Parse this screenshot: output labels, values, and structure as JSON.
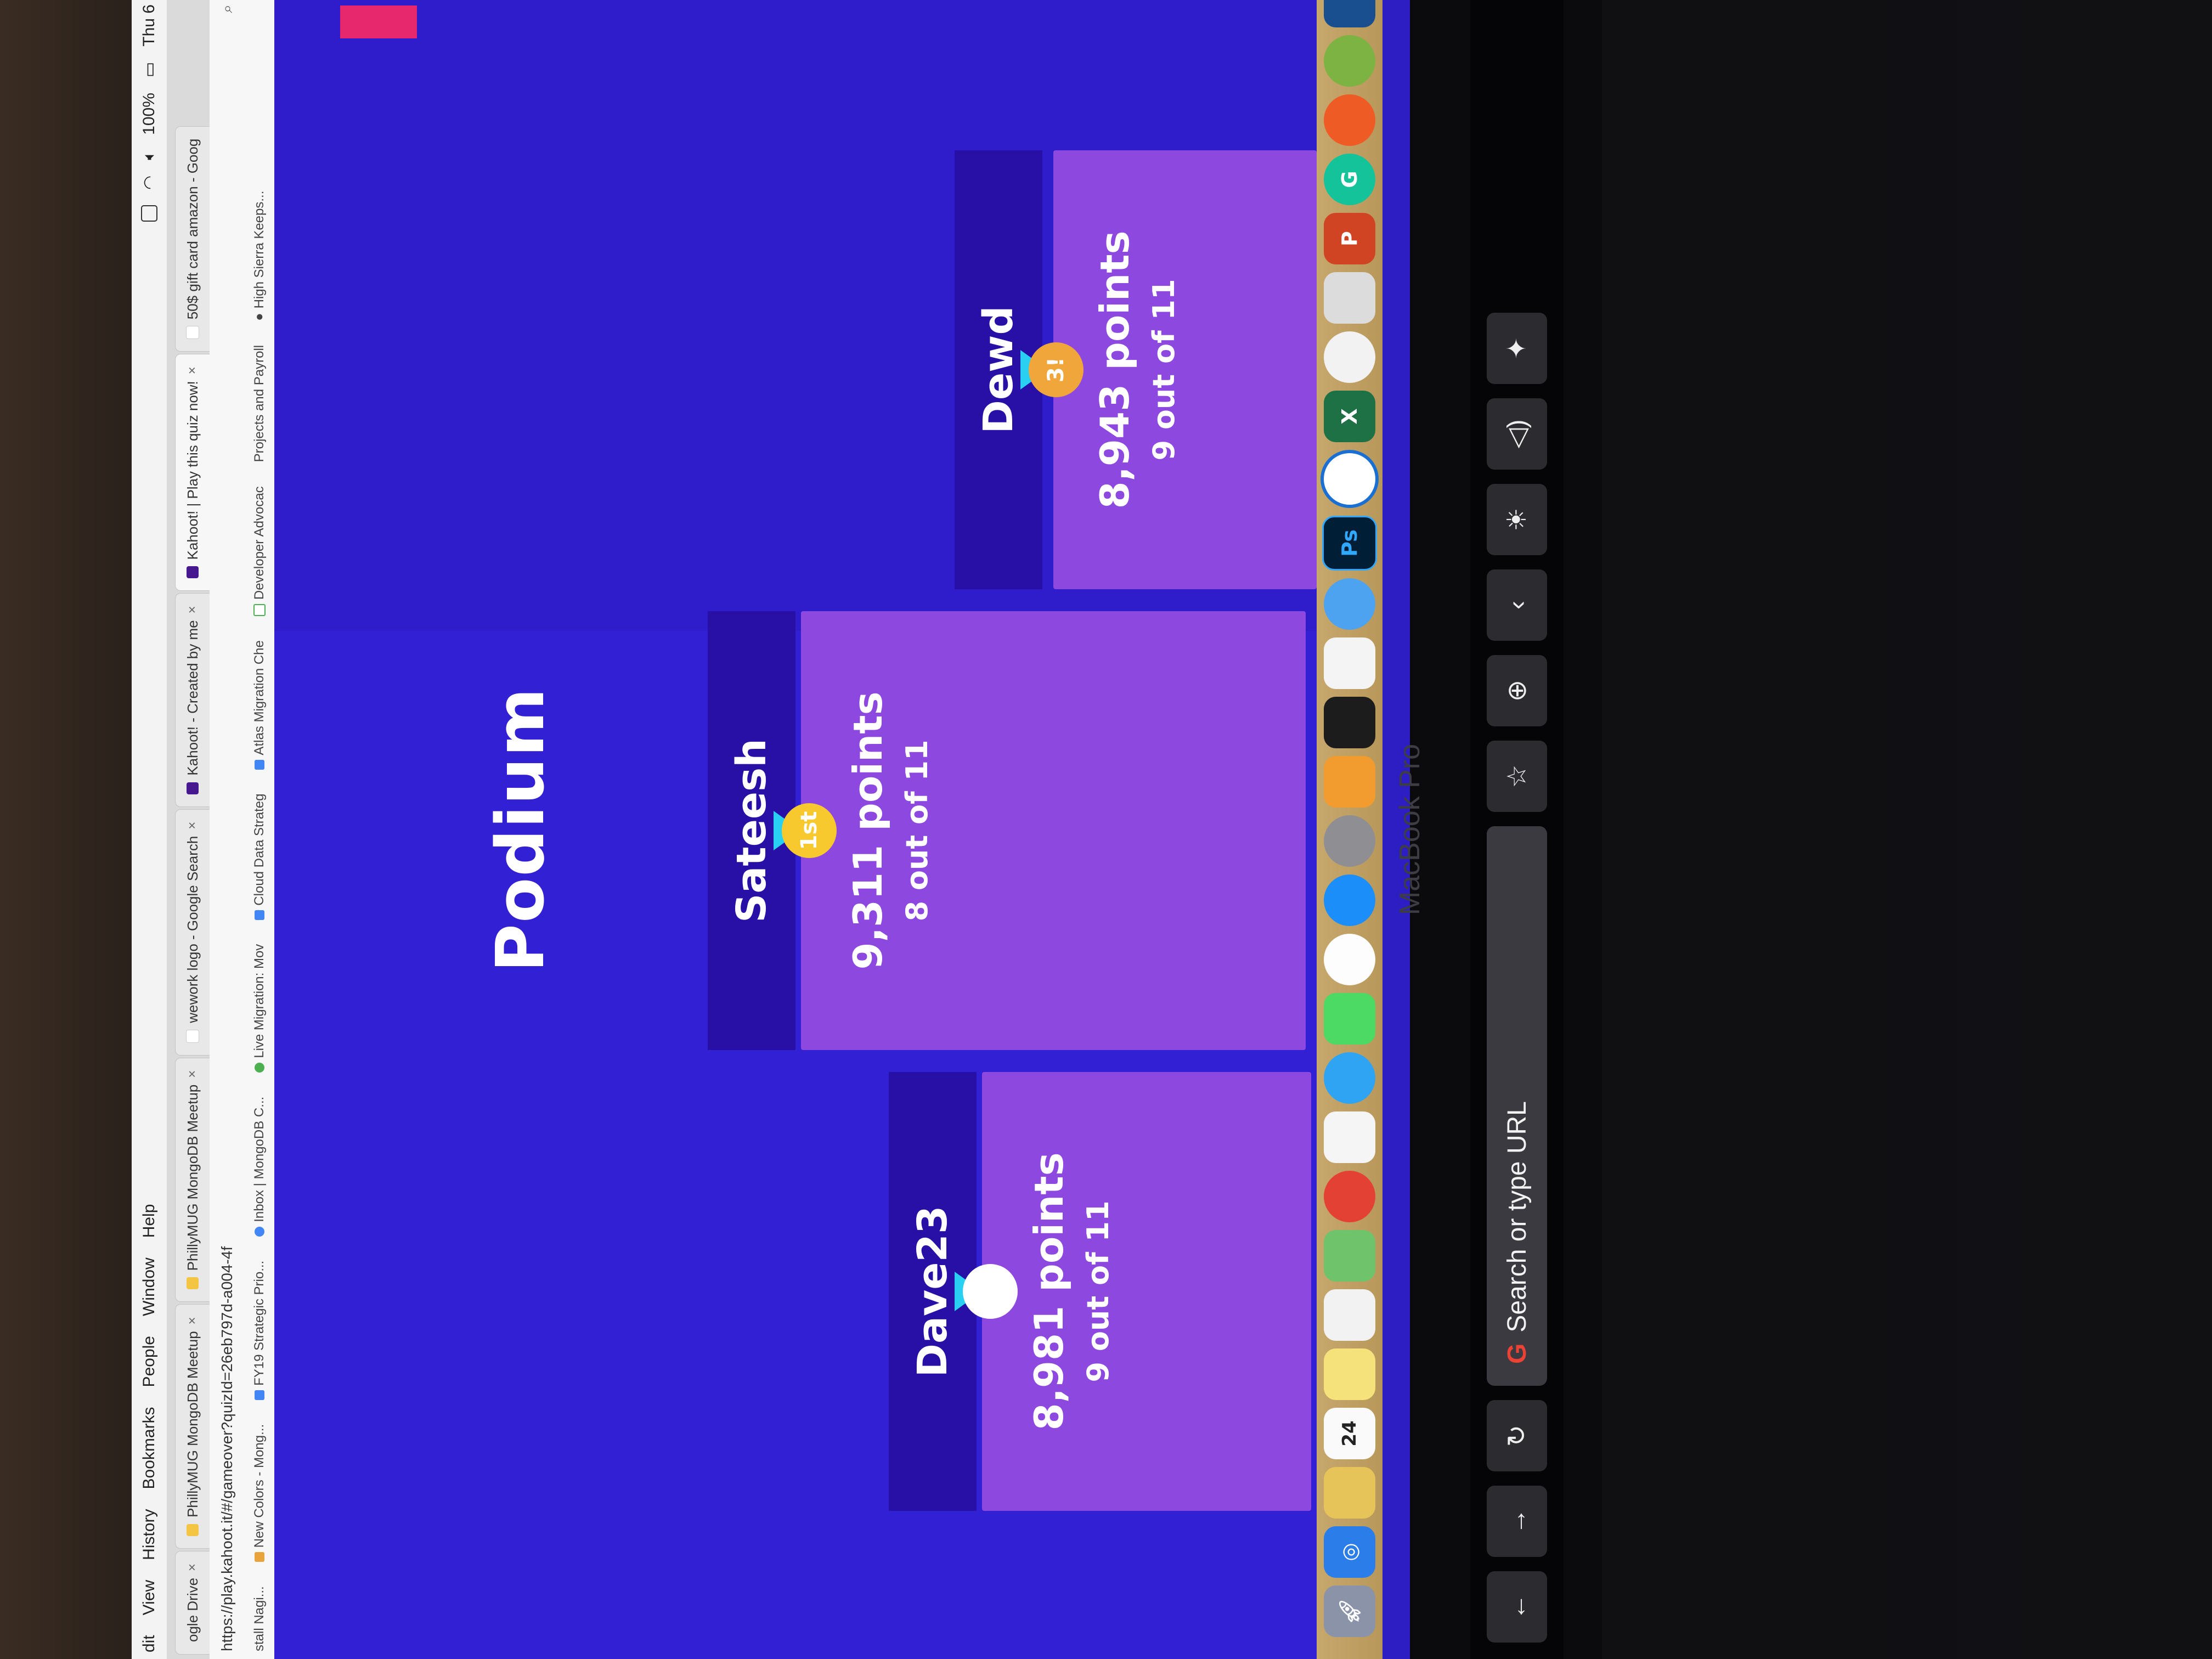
{
  "menubar": {
    "items": [
      "dit",
      "View",
      "History",
      "Bookmarks",
      "People",
      "Window",
      "Help"
    ],
    "right": [
      "100%",
      "Thu 6"
    ]
  },
  "tabs": [
    {
      "label": "ogle Drive"
    },
    {
      "label": "PhillyMUG MongoDB Meetup"
    },
    {
      "label": "PhillyMUG MongoDB Meetup"
    },
    {
      "label": "wework logo - Google Search"
    },
    {
      "label": "Kahoot! - Created by me"
    },
    {
      "label": "Kahoot! | Play this quiz now!"
    },
    {
      "label": "50$ gift card amazon - Goog"
    }
  ],
  "address": {
    "url": "https://play.kahoot.it/#/gameover?quizId=26eb797d-a004-4f"
  },
  "bookmarks": [
    "stall Nagi...",
    "New Colors - Mong...",
    "FY19 Strategic Prio...",
    "Inbox | MongoDB C...",
    "Live Migration: Mov",
    "Cloud Data Strateg",
    "Atlas Migration Che",
    "Developer Advocac",
    "Projects and Payroll",
    "High Sierra Keeps..."
  ],
  "podium": {
    "title": "Podium",
    "players": [
      {
        "name": "Dave23",
        "points": "8,981 points",
        "correct": "9 out of 11",
        "rank": 2,
        "medal_color": "#ffffff",
        "medal_text": ""
      },
      {
        "name": "Sateesh",
        "points": "9,311 points",
        "correct": "8 out of 11",
        "rank": 1,
        "medal_color": "#f7c92f",
        "medal_text": "1st"
      },
      {
        "name": "Dewd",
        "points": "8,943 points",
        "correct": "9 out of 11",
        "rank": 3,
        "medal_color": "#f0a63a",
        "medal_text": "3!"
      }
    ]
  },
  "dock": {
    "icons": [
      "rocket",
      "safari",
      "notes",
      "calendar",
      "stickies",
      "reminders",
      "maps",
      "chrome",
      "photos",
      "messages",
      "facetime",
      "itunes",
      "app-store",
      "system-preferences",
      "ibooks",
      "terminal",
      "slack",
      "lock",
      "photoshop",
      "1password",
      "excel",
      "mongodb-compass",
      "robo3t",
      "powerpoint",
      "grammarly",
      "postman",
      "chat",
      "mysql-workbench"
    ],
    "date_badge": "24"
  },
  "laptop": {
    "brand": "MacBook Pro"
  },
  "touchbar": {
    "search_placeholder": "Search or type URL"
  },
  "colors": {
    "kahoot_bg": "#3220d4",
    "name_box": "#2810a6",
    "score_box": "#8d48e0",
    "pink_accent": "#e7286d",
    "ribbon": "#2ad0f2"
  }
}
